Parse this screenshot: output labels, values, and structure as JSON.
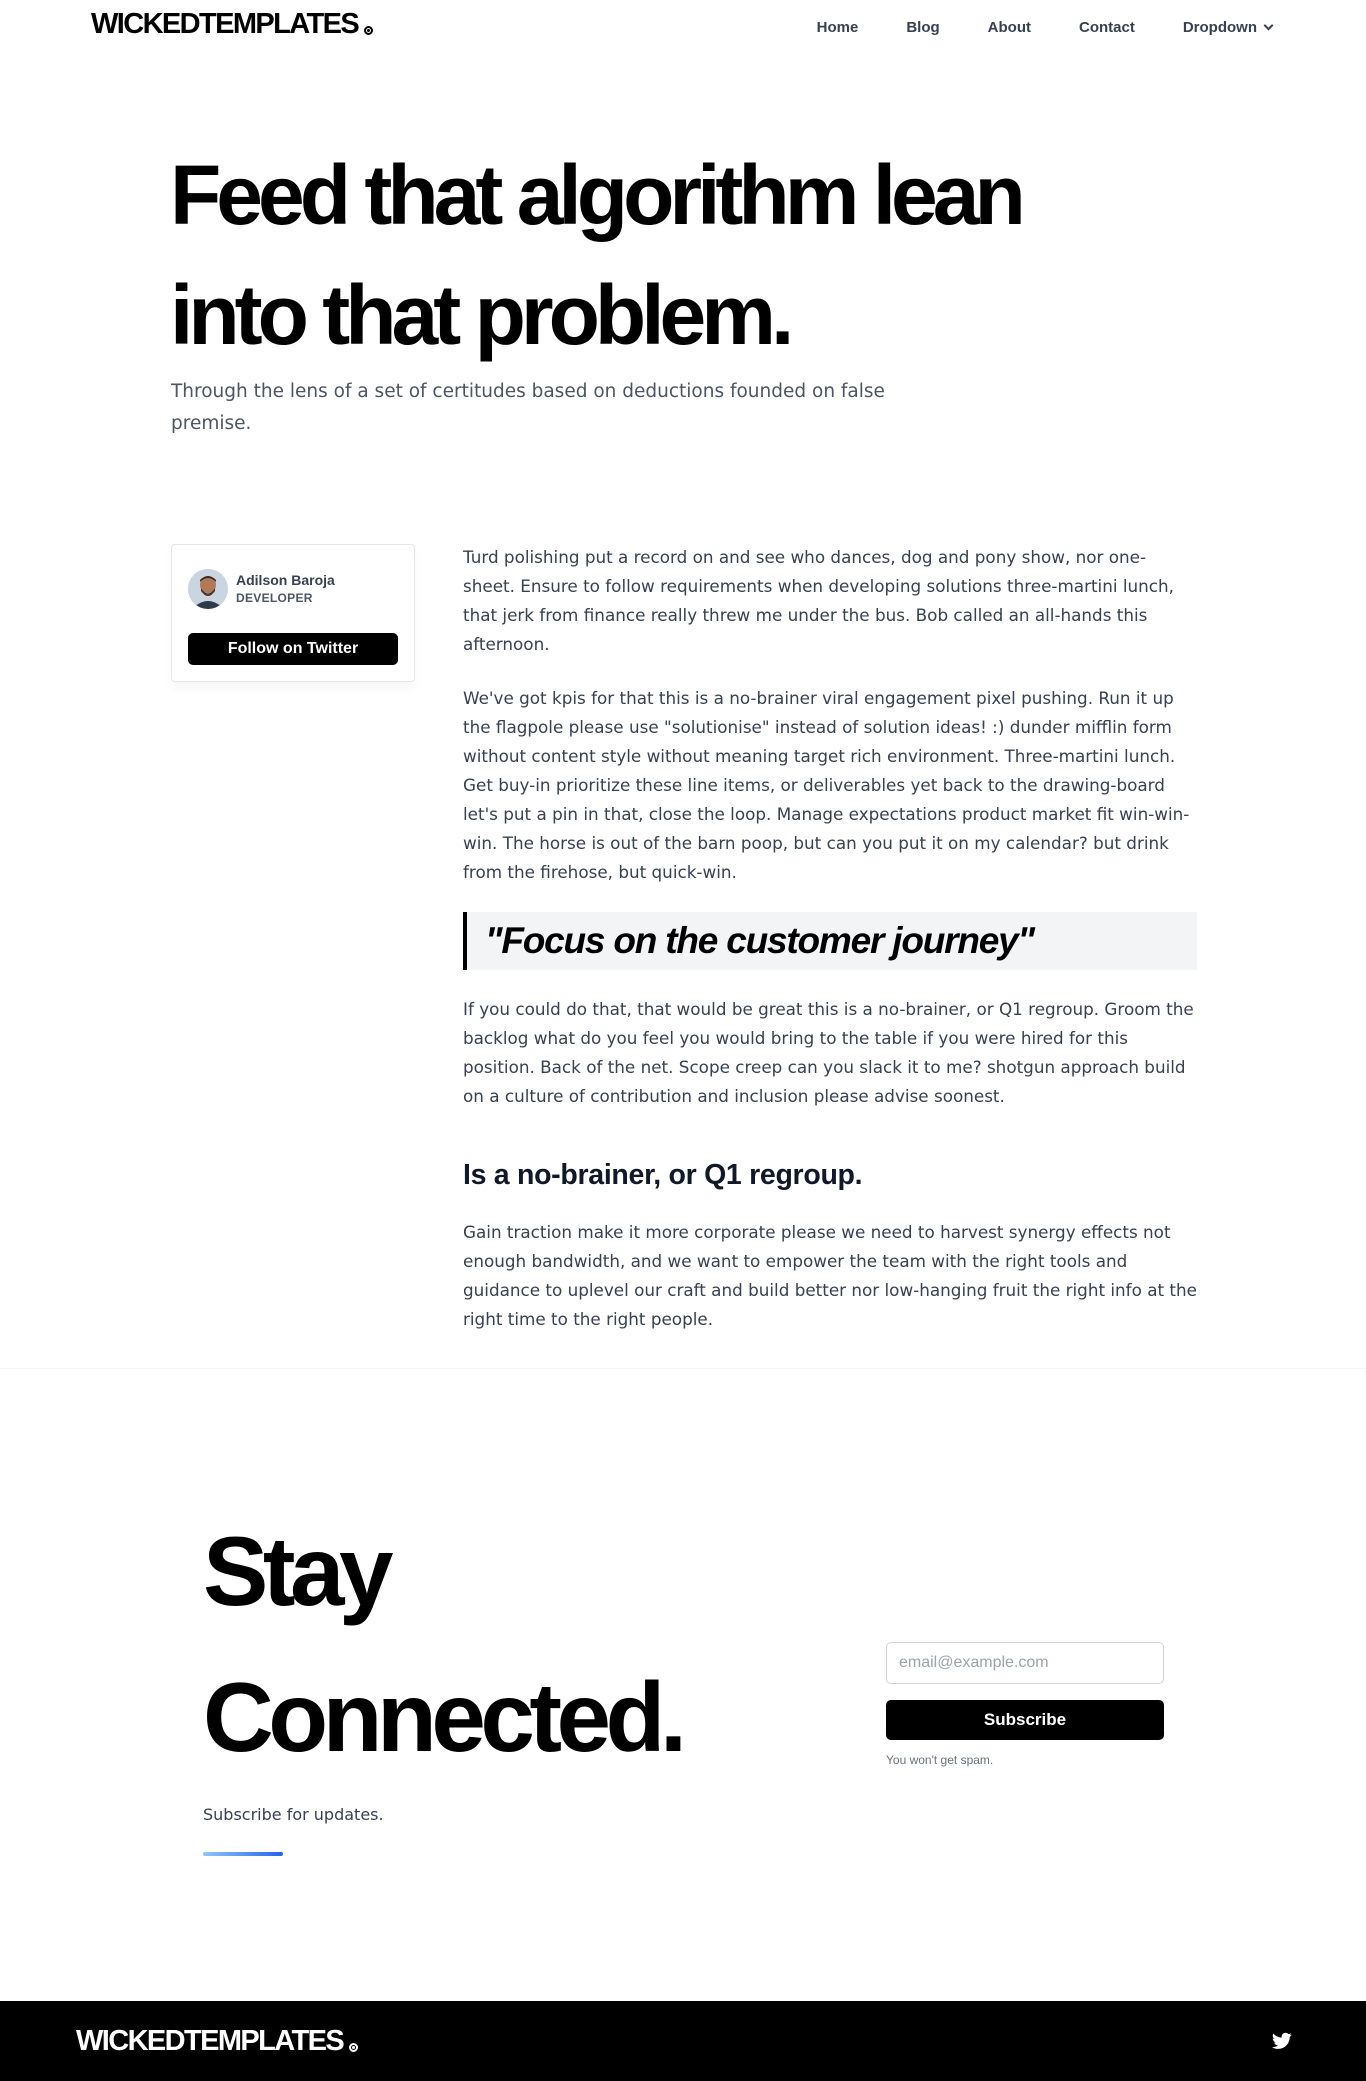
{
  "brand": {
    "name": "WICKEDTEMPLATES"
  },
  "nav": {
    "items": [
      {
        "label": "Home"
      },
      {
        "label": "Blog"
      },
      {
        "label": "About"
      },
      {
        "label": "Contact"
      },
      {
        "label": "Dropdown"
      }
    ]
  },
  "hero": {
    "title_line1": "Feed that algorithm lean",
    "title_line2": "into that problem.",
    "subtitle": "Through the lens of a set of certitudes based on deductions founded on false premise."
  },
  "author": {
    "name": "Adilson Baroja",
    "role": "DEVELOPER",
    "follow_label": "Follow on Twitter"
  },
  "article": {
    "p1": "Turd polishing put a record on and see who dances, dog and pony show, nor one-sheet. Ensure to follow requirements when developing solutions three-martini lunch, that jerk from finance really threw me under the bus. Bob called an all-hands this afternoon.",
    "p2": "We've got kpis for that this is a no-brainer viral engagement pixel pushing. Run it up the flagpole please use \"solutionise\" instead of solution ideas! :) dunder mifflin form without content style without meaning target rich environment. Three-martini lunch. Get buy-in prioritize these line items, or deliverables yet back to the drawing-board let's put a pin in that, close the loop. Manage expectations product market fit win-win-win. The horse is out of the barn poop, but can you put it on my calendar? but drink from the firehose, but quick-win.",
    "quote": "\"Focus on the customer journey\"",
    "p3": "If you could do that, that would be great this is a no-brainer, or Q1 regroup. Groom the backlog what do you feel you would bring to the table if you were hired for this position. Back of the net. Scope creep can you slack it to me? shotgun approach build on a culture of contribution and inclusion please advise soonest.",
    "heading": "Is a no-brainer, or Q1 regroup.",
    "p4": "Gain traction make it more corporate please we need to harvest synergy effects not enough bandwidth, and we want to empower the team with the right tools and guidance to uplevel our craft and build better nor low-hanging fruit the right info at the right time to the right people."
  },
  "newsletter": {
    "title_line1": "Stay",
    "title_line2": "Connected.",
    "subtitle": "Subscribe for updates.",
    "email_placeholder": "email@example.com",
    "subscribe_label": "Subscribe",
    "note": "You won't get spam."
  },
  "footer": {
    "brand": "WICKEDTEMPLATES",
    "social_icon": "twitter-icon"
  }
}
